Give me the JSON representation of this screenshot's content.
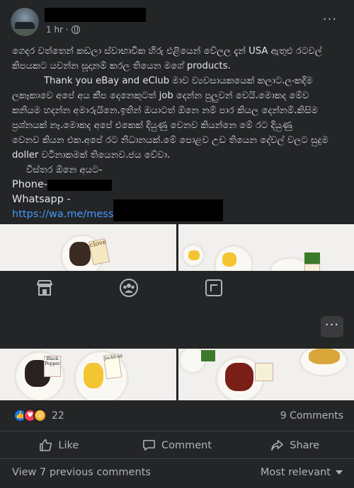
{
  "header": {
    "time": "1 hr ·",
    "more": "···"
  },
  "post": {
    "lines": [
      "ගෙදර වත්තෙන් කඩලා ස්වාභාවික හිරු එළියෙන් වේලල දැන් USA ඇතුළු රටවල්",
      "කිපයකට යවන්න සූදානම් කරල තියෙන මගේ products.",
      "Thank you eBay and eClub මාව ව්‍යවසායකයෙක් කලාට.ලංකදිම",
      "ලකෑකාවෙ අපේ අය කීප දෙනෙකුටත් job දෙන්න පුලුවන් වෙයි.මොකද මේව",
      "කනියම හදන්න අමාරුයිනෙ.ඉතින් ඔයාටත් ඕනෙ නම් පාර කියල දෙන්නම්.කිසිම",
      "ප්‍රශ්නයක් නෑ.මොකද අපේ එකෙක් දියුණු වෙනව කියන්නෙ මේ රට දියුණු",
      "වෙනව කියන එක.අපේ රට නිධානයක්.මේ පොළව උඩ තියෙන දේවල් වලට සුදුම",
      "doller වටිනාකමක් තියෙනව.ජය වේවා.",
      "විස්තර ඕනෙ අයට-"
    ],
    "phone_label": "Phone-",
    "whatsapp_label": "Whatsapp -",
    "link_text": "https://wa.me/mess"
  },
  "images": {
    "img1_label": "clove",
    "img3_label_a": "Black Pepper",
    "img3_label_b": "Jackfruit"
  },
  "stats": {
    "reaction_count": "22",
    "comments": "9 Comments"
  },
  "actions": {
    "like": "Like",
    "comment": "Comment",
    "share": "Share"
  },
  "footer": {
    "view_previous": "View 7 previous comments",
    "sort": "Most relevant"
  },
  "icons": [
    "store-icon",
    "groups-icon",
    "marketplace-icon",
    "like-icon",
    "comment-icon",
    "share-icon",
    "globe-icon"
  ],
  "colors": {
    "background": "#242526",
    "text": "#e4e6eb",
    "muted": "#b0b3b8",
    "link": "#4599ff",
    "like": "#1877f2",
    "love": "#f33e58",
    "wow": "#f7b125"
  }
}
